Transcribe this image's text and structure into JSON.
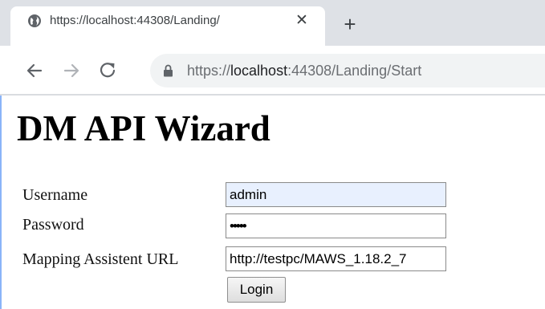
{
  "browser": {
    "tab": {
      "title": "https://localhost:44308/Landing/",
      "close_glyph": "✕",
      "favicon": "globe-icon"
    },
    "new_tab_glyph": "+",
    "nav": {
      "back": "arrow-left-icon",
      "forward": "arrow-right-icon",
      "reload": "reload-icon"
    },
    "address": {
      "scheme": "https://",
      "host": "localhost",
      "rest": ":44308/Landing/Start",
      "lock": "lock-icon"
    }
  },
  "page": {
    "title": "DM API Wizard",
    "form": {
      "username_label": "Username",
      "username_value": "admin",
      "password_label": "Password",
      "password_value": "•••••",
      "url_label": "Mapping Assistent URL",
      "url_value": "http://testpc/MAWS_1.18.2_7",
      "login_label": "Login"
    }
  },
  "colors": {
    "tabstrip": "#dee1e6",
    "omnibox": "#f1f3f4",
    "autofill": "#e8f0fe"
  }
}
